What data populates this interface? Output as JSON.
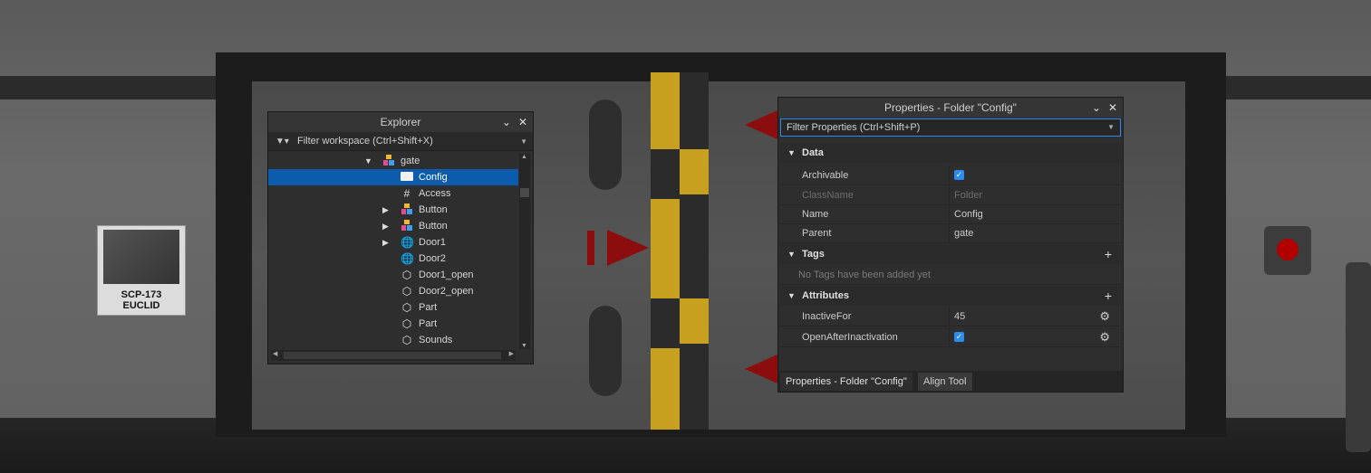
{
  "scene": {
    "sign_title": "SCP-173",
    "sign_class": "EUCLID"
  },
  "explorer": {
    "title": "Explorer",
    "filter_placeholder": "Filter workspace (Ctrl+Shift+X)",
    "items": [
      {
        "label": "gate",
        "icon": "model-icon",
        "expand": "expanded"
      },
      {
        "label": "Config",
        "icon": "folder-icon",
        "expand": "none",
        "selected": true
      },
      {
        "label": "Access",
        "icon": "number-value-icon",
        "expand": "none"
      },
      {
        "label": "Button",
        "icon": "model-icon",
        "expand": "collapsed"
      },
      {
        "label": "Button",
        "icon": "model-icon",
        "expand": "collapsed"
      },
      {
        "label": "Door1",
        "icon": "union-icon",
        "expand": "collapsed"
      },
      {
        "label": "Door2",
        "icon": "union-icon",
        "expand": "none"
      },
      {
        "label": "Door1_open",
        "icon": "part-icon",
        "expand": "none"
      },
      {
        "label": "Door2_open",
        "icon": "part-icon",
        "expand": "none"
      },
      {
        "label": "Part",
        "icon": "part-icon",
        "expand": "none"
      },
      {
        "label": "Part",
        "icon": "part-icon",
        "expand": "none"
      },
      {
        "label": "Sounds",
        "icon": "part-icon",
        "expand": "none"
      }
    ]
  },
  "properties": {
    "title": "Properties - Folder \"Config\"",
    "filter_placeholder": "Filter Properties (Ctrl+Shift+P)",
    "data_section": "Data",
    "rows": [
      {
        "key": "Archivable",
        "value": "",
        "checkbox": true
      },
      {
        "key": "ClassName",
        "value": "Folder",
        "disabled": true
      },
      {
        "key": "Name",
        "value": "Config"
      },
      {
        "key": "Parent",
        "value": "gate"
      }
    ],
    "tags_section": "Tags",
    "tags_empty": "No Tags have been added yet",
    "attributes_section": "Attributes",
    "attributes": [
      {
        "key": "InactiveFor",
        "value": "45"
      },
      {
        "key": "OpenAfterInactivation",
        "value": "",
        "checkbox": true
      }
    ],
    "tabs": [
      "Properties - Folder \"Config\"",
      "Align Tool"
    ],
    "colors": {
      "accent": "#0b5cad",
      "checkbox": "#2d8cf0"
    }
  }
}
